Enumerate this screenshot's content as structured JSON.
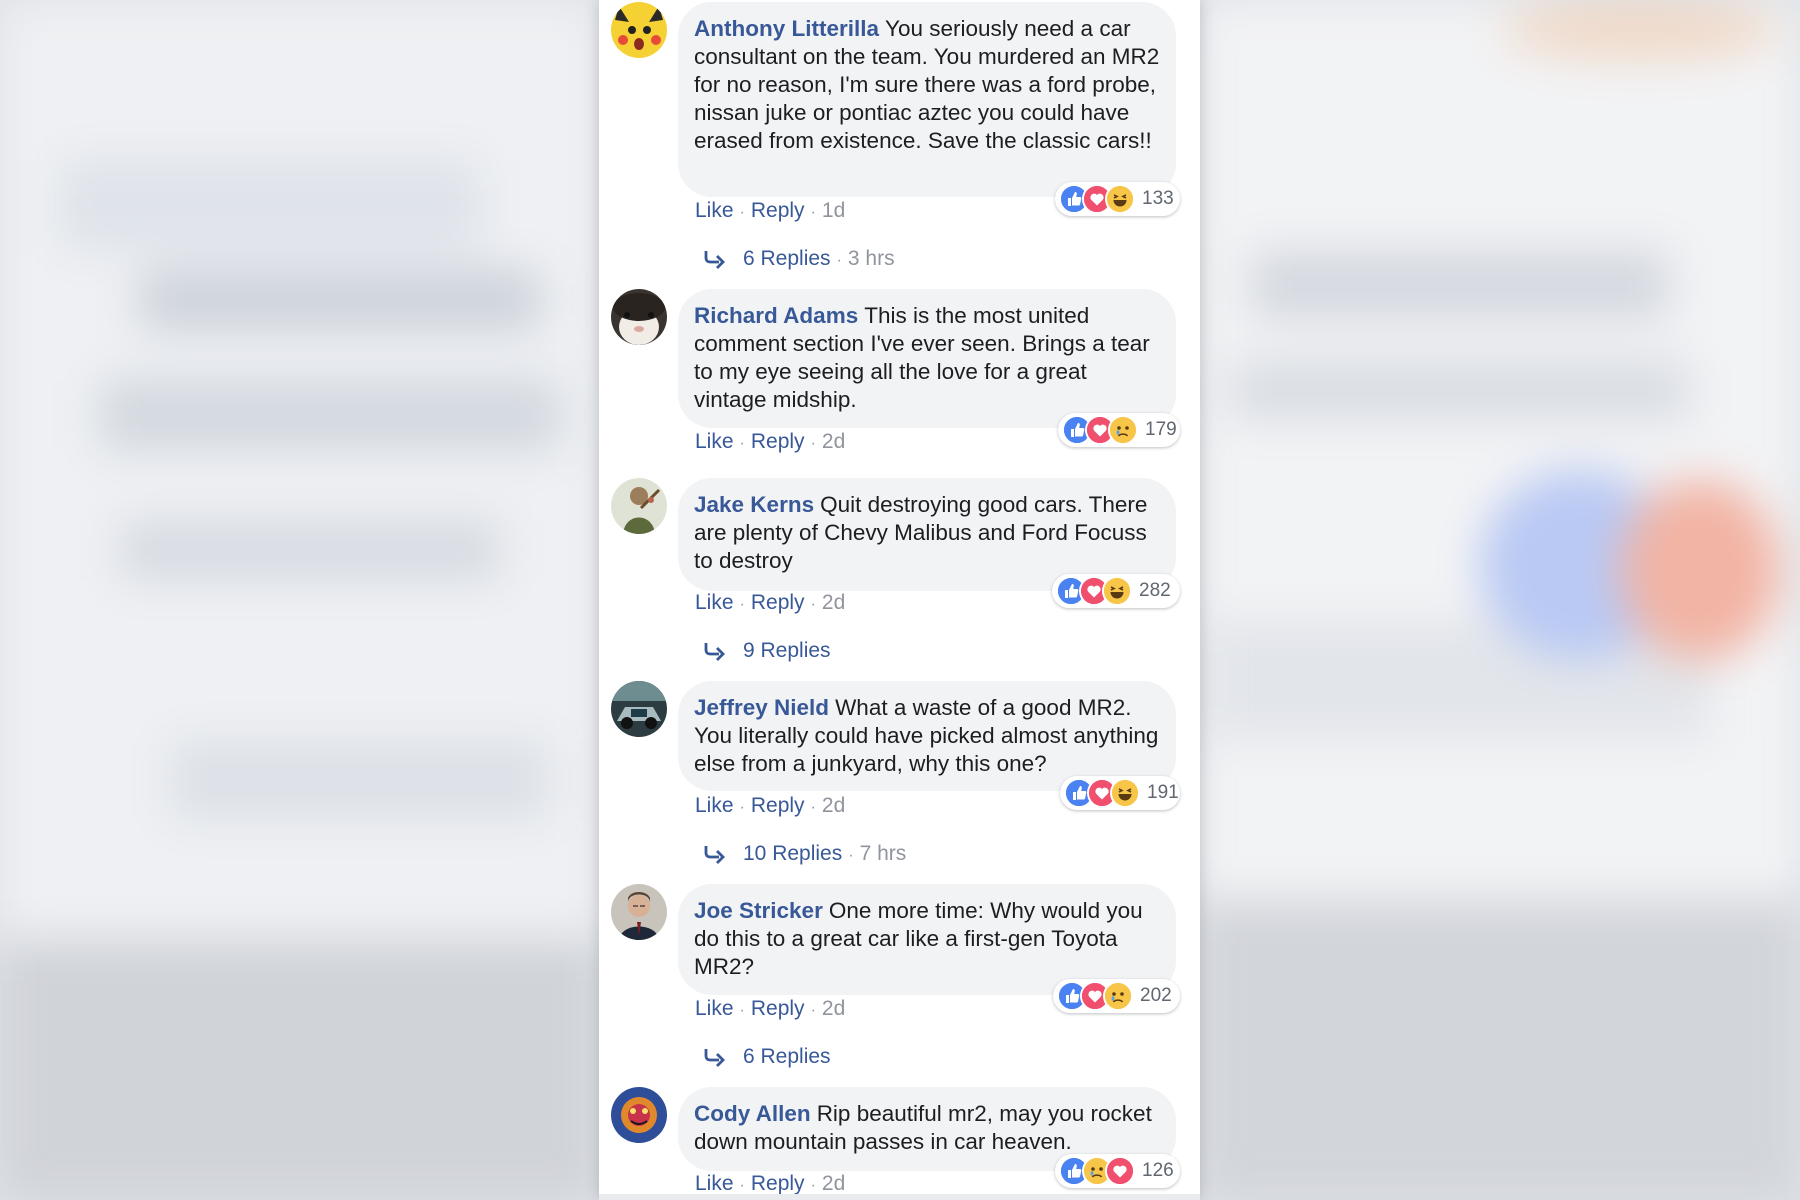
{
  "comments": [
    {
      "author": "Anthony Litterilla",
      "text": "You seriously need a car consultant on the team. You murdered an MR2 for no reason, I'm sure there was a ford probe, nissan juke or pontiac aztec you could have erased from existence. Save the classic cars!!",
      "avatar": "pikachu-avatar",
      "reactions": [
        "like",
        "love",
        "haha"
      ],
      "reaction_count": "133",
      "like_label": "Like",
      "reply_label": "Reply",
      "time": "1d",
      "replies_label": "6 Replies",
      "replies_time": "3 hrs"
    },
    {
      "author": "Richard Adams",
      "text": "This is the most united comment section I've ever seen. Brings a tear to my eye seeing all the love for a great vintage midship.",
      "avatar": "guinea-pig-avatar",
      "reactions": [
        "like",
        "love",
        "sad"
      ],
      "reaction_count": "179",
      "like_label": "Like",
      "reply_label": "Reply",
      "time": "2d"
    },
    {
      "author": "Jake Kerns",
      "text": "Quit destroying good cars. There are plenty of Chevy Malibus and Ford Focuss to destroy",
      "avatar": "person-avatar",
      "reactions": [
        "like",
        "love",
        "haha"
      ],
      "reaction_count": "282",
      "like_label": "Like",
      "reply_label": "Reply",
      "time": "2d",
      "replies_label": "9 Replies"
    },
    {
      "author": "Jeffrey Nield",
      "text": "What a waste of a good MR2. You literally could have picked almost anything else from a junkyard, why this one?",
      "avatar": "car-photo-avatar",
      "reactions": [
        "like",
        "love",
        "haha"
      ],
      "reaction_count": "191",
      "like_label": "Like",
      "reply_label": "Reply",
      "time": "2d",
      "replies_label": "10 Replies",
      "replies_time": "7 hrs"
    },
    {
      "author": "Joe Stricker",
      "text": "One more time: Why would you do this to a great car like a first-gen Toyota MR2?",
      "avatar": "man-portrait-avatar",
      "reactions": [
        "like",
        "love",
        "sad"
      ],
      "reaction_count": "202",
      "like_label": "Like",
      "reply_label": "Reply",
      "time": "2d",
      "replies_label": "6 Replies"
    },
    {
      "author": "Cody Allen",
      "text": "Rip beautiful mr2, may you rocket down mountain passes in car heaven.",
      "avatar": "colorful-art-avatar",
      "reactions": [
        "like",
        "sad",
        "love"
      ],
      "reaction_count": "126",
      "like_label": "Like",
      "reply_label": "Reply",
      "time": "2d"
    }
  ],
  "colors": {
    "link": "#385898",
    "bubble": "#f2f3f5",
    "text": "#1c1e21",
    "meta_gray": "#90949c",
    "like_blue": "#4a82f2",
    "love_red": "#f0506e",
    "emoji_yellow": "#f7c548"
  }
}
